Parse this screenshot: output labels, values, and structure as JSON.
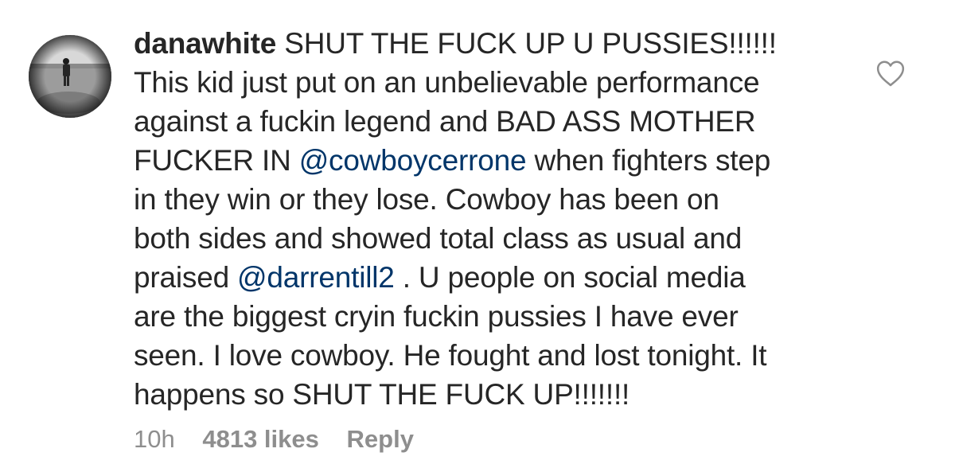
{
  "comment": {
    "username": "danawhite",
    "lines": [
      [
        {
          "t": "SHUT THE FUCK UP U PUSSIES!!!!!!"
        }
      ],
      [
        {
          "t": "This kid just put on an unbelievable performance"
        }
      ],
      [
        {
          "t": "against a fuckin legend and BAD ASS MOTHER"
        }
      ],
      [
        {
          "t": "FUCKER IN "
        },
        {
          "t": "@cowboycerrone",
          "mention": true
        },
        {
          "t": " when fighters step"
        }
      ],
      [
        {
          "t": "in they win or they lose. Cowboy has been on"
        }
      ],
      [
        {
          "t": "both sides and showed total class as usual and"
        }
      ],
      [
        {
          "t": "praised "
        },
        {
          "t": "@darrentill2",
          "mention": true
        },
        {
          "t": " . U people on social media"
        }
      ],
      [
        {
          "t": "are the biggest cryin fuckin pussies I have ever"
        }
      ],
      [
        {
          "t": "seen. I love cowboy. He fought and lost tonight. It"
        }
      ],
      [
        {
          "t": "happens so SHUT THE FUCK UP!!!!!!!"
        }
      ]
    ],
    "time": "10h",
    "likes": "4813 likes",
    "reply_label": "Reply",
    "heart_icon": "heart-outline-icon",
    "avatar_icon": "profile-avatar"
  },
  "colors": {
    "text": "#262626",
    "mention": "#003569",
    "meta": "#8e8e8e",
    "heart": "#8e8e8e"
  }
}
